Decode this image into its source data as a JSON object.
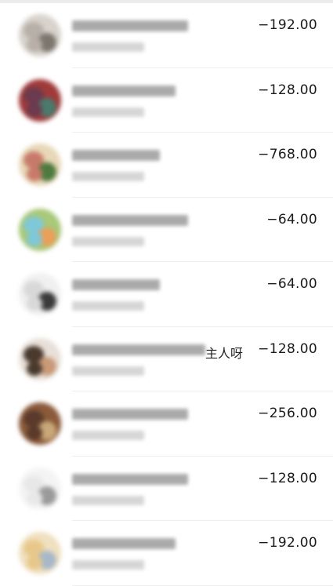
{
  "transactions": [
    {
      "title": "",
      "subtitle": "",
      "amount": "−192.00",
      "avatar_colors": [
        "#b8b0a8",
        "#7c766f",
        "#d8d3cc"
      ]
    },
    {
      "title": "",
      "subtitle": "",
      "amount": "−128.00",
      "avatar_colors": [
        "#6b3a4e",
        "#4a7a6b",
        "#a03a3a"
      ]
    },
    {
      "title": "",
      "subtitle": "",
      "amount": "−768.00",
      "avatar_colors": [
        "#c87a6a",
        "#4e7a3e",
        "#e8d8b8"
      ]
    },
    {
      "title": "",
      "subtitle": "",
      "amount": "−64.00",
      "avatar_colors": [
        "#7ec8d8",
        "#e8a05a",
        "#a8c87a"
      ]
    },
    {
      "title": "",
      "subtitle": "",
      "amount": "−64.00",
      "avatar_colors": [
        "#d8d8d8",
        "#3a3a3a",
        "#f0f0f0"
      ]
    },
    {
      "title": "主人呀",
      "subtitle": "",
      "amount": "−128.00",
      "avatar_colors": [
        "#4a3a2e",
        "#c89a78",
        "#e8e0d8"
      ]
    },
    {
      "title": "",
      "subtitle": "",
      "amount": "−256.00",
      "avatar_colors": [
        "#5a3a2a",
        "#c8a878",
        "#8a5a3a"
      ]
    },
    {
      "title": "",
      "subtitle": "",
      "amount": "−128.00",
      "avatar_colors": [
        "#e8e8e8",
        "#9a9a9a",
        "#f4f4f4"
      ]
    },
    {
      "title": "",
      "subtitle": "",
      "amount": "−192.00",
      "avatar_colors": [
        "#e8c88a",
        "#a8b8c8",
        "#f0e0c0"
      ]
    }
  ]
}
